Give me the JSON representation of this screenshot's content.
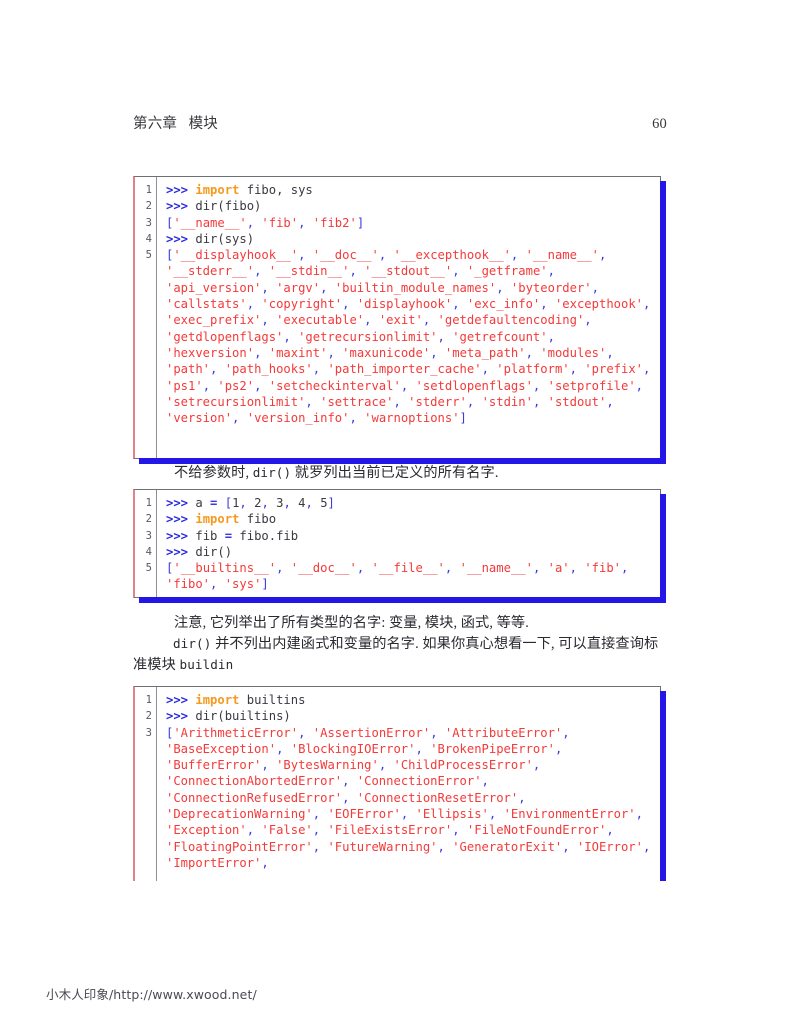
{
  "header": {
    "title": "第六章   模块",
    "page_number": "60"
  },
  "listings": [
    {
      "name": "dir-fibo-sys-listing",
      "line_numbers": [
        "1",
        "2",
        "3",
        "4",
        "5"
      ],
      "lines": [
        [
          {
            "t": ">>> ",
            "c": "prompt"
          },
          {
            "t": "import",
            "c": "kw"
          },
          {
            "t": " fibo, sys",
            "c": "plain"
          }
        ],
        [
          {
            "t": ">>> ",
            "c": "prompt"
          },
          {
            "t": "dir(fibo)",
            "c": "plain"
          }
        ],
        [
          {
            "t": "[",
            "c": "punct"
          },
          {
            "t": "'__name__'",
            "c": "str"
          },
          {
            "t": ", ",
            "c": "punct"
          },
          {
            "t": "'fib'",
            "c": "str"
          },
          {
            "t": ", ",
            "c": "punct"
          },
          {
            "t": "'fib2'",
            "c": "str"
          },
          {
            "t": "]",
            "c": "punct"
          }
        ],
        [
          {
            "t": ">>> ",
            "c": "prompt"
          },
          {
            "t": "dir(sys)",
            "c": "plain"
          }
        ],
        [
          {
            "t": "[",
            "c": "punct"
          },
          {
            "t": "'__displayhook__'",
            "c": "str"
          },
          {
            "t": ", ",
            "c": "punct"
          },
          {
            "t": "'__doc__'",
            "c": "str"
          },
          {
            "t": ", ",
            "c": "punct"
          },
          {
            "t": "'__excepthook__'",
            "c": "str"
          },
          {
            "t": ", ",
            "c": "punct"
          },
          {
            "t": "'__name__'",
            "c": "str"
          },
          {
            "t": ", ",
            "c": "punct"
          },
          {
            "t": "'__stderr__'",
            "c": "str"
          },
          {
            "t": ", ",
            "c": "punct"
          },
          {
            "t": "'__stdin__'",
            "c": "str"
          },
          {
            "t": ", ",
            "c": "punct"
          },
          {
            "t": "'__stdout__'",
            "c": "str"
          },
          {
            "t": ", ",
            "c": "punct"
          },
          {
            "t": "'_getframe'",
            "c": "str"
          },
          {
            "t": ", ",
            "c": "punct"
          },
          {
            "t": "'api_version'",
            "c": "str"
          },
          {
            "t": ", ",
            "c": "punct"
          },
          {
            "t": "'argv'",
            "c": "str"
          },
          {
            "t": ", ",
            "c": "punct"
          },
          {
            "t": "'builtin_module_names'",
            "c": "str"
          },
          {
            "t": ", ",
            "c": "punct"
          },
          {
            "t": "'byteorder'",
            "c": "str"
          },
          {
            "t": ", ",
            "c": "punct"
          },
          {
            "t": "'callstats'",
            "c": "str"
          },
          {
            "t": ", ",
            "c": "punct"
          },
          {
            "t": "'copyright'",
            "c": "str"
          },
          {
            "t": ", ",
            "c": "punct"
          },
          {
            "t": "'displayhook'",
            "c": "str"
          },
          {
            "t": ", ",
            "c": "punct"
          },
          {
            "t": "'exc_info'",
            "c": "str"
          },
          {
            "t": ", ",
            "c": "punct"
          },
          {
            "t": "'excepthook'",
            "c": "str"
          },
          {
            "t": ", ",
            "c": "punct"
          },
          {
            "t": "'exec_prefix'",
            "c": "str"
          },
          {
            "t": ", ",
            "c": "punct"
          },
          {
            "t": "'executable'",
            "c": "str"
          },
          {
            "t": ", ",
            "c": "punct"
          },
          {
            "t": "'exit'",
            "c": "str"
          },
          {
            "t": ", ",
            "c": "punct"
          },
          {
            "t": "'getdefaultencoding'",
            "c": "str"
          },
          {
            "t": ", ",
            "c": "punct"
          },
          {
            "t": "'getdlopenflags'",
            "c": "str"
          },
          {
            "t": ", ",
            "c": "punct"
          },
          {
            "t": "'getrecursionlimit'",
            "c": "str"
          },
          {
            "t": ", ",
            "c": "punct"
          },
          {
            "t": "'getrefcount'",
            "c": "str"
          },
          {
            "t": ", ",
            "c": "punct"
          },
          {
            "t": "'hexversion'",
            "c": "str"
          },
          {
            "t": ", ",
            "c": "punct"
          },
          {
            "t": "'maxint'",
            "c": "str"
          },
          {
            "t": ", ",
            "c": "punct"
          },
          {
            "t": "'maxunicode'",
            "c": "str"
          },
          {
            "t": ", ",
            "c": "punct"
          },
          {
            "t": "'meta_path'",
            "c": "str"
          },
          {
            "t": ", ",
            "c": "punct"
          },
          {
            "t": "'modules'",
            "c": "str"
          },
          {
            "t": ", ",
            "c": "punct"
          },
          {
            "t": "'path'",
            "c": "str"
          },
          {
            "t": ", ",
            "c": "punct"
          },
          {
            "t": "'path_hooks'",
            "c": "str"
          },
          {
            "t": ", ",
            "c": "punct"
          },
          {
            "t": "'path_importer_cache'",
            "c": "str"
          },
          {
            "t": ", ",
            "c": "punct"
          },
          {
            "t": "'platform'",
            "c": "str"
          },
          {
            "t": ", ",
            "c": "punct"
          },
          {
            "t": "'prefix'",
            "c": "str"
          },
          {
            "t": ", ",
            "c": "punct"
          },
          {
            "t": "'ps1'",
            "c": "str"
          },
          {
            "t": ", ",
            "c": "punct"
          },
          {
            "t": "'ps2'",
            "c": "str"
          },
          {
            "t": ", ",
            "c": "punct"
          },
          {
            "t": "'setcheckinterval'",
            "c": "str"
          },
          {
            "t": ", ",
            "c": "punct"
          },
          {
            "t": "'setdlopenflags'",
            "c": "str"
          },
          {
            "t": ", ",
            "c": "punct"
          },
          {
            "t": "'setprofile'",
            "c": "str"
          },
          {
            "t": ", ",
            "c": "punct"
          },
          {
            "t": "'setrecursionlimit'",
            "c": "str"
          },
          {
            "t": ", ",
            "c": "punct"
          },
          {
            "t": "'settrace'",
            "c": "str"
          },
          {
            "t": ", ",
            "c": "punct"
          },
          {
            "t": "'stderr'",
            "c": "str"
          },
          {
            "t": ", ",
            "c": "punct"
          },
          {
            "t": "'stdin'",
            "c": "str"
          },
          {
            "t": ", ",
            "c": "punct"
          },
          {
            "t": "'stdout'",
            "c": "str"
          },
          {
            "t": ", ",
            "c": "punct"
          },
          {
            "t": "'version'",
            "c": "str"
          },
          {
            "t": ", ",
            "c": "punct"
          },
          {
            "t": "'version_info'",
            "c": "str"
          },
          {
            "t": ", ",
            "c": "punct"
          },
          {
            "t": "'warnoptions'",
            "c": "str"
          },
          {
            "t": "]",
            "c": "punct"
          }
        ]
      ]
    },
    {
      "name": "dir-no-args-listing",
      "line_numbers": [
        "1",
        "2",
        "3",
        "4",
        "5"
      ],
      "lines": [
        [
          {
            "t": ">>> ",
            "c": "prompt"
          },
          {
            "t": "a ",
            "c": "plain"
          },
          {
            "t": "=",
            "c": "op"
          },
          {
            "t": " ",
            "c": "plain"
          },
          {
            "t": "[",
            "c": "punct"
          },
          {
            "t": "1",
            "c": "num"
          },
          {
            "t": ", ",
            "c": "punct"
          },
          {
            "t": "2",
            "c": "num"
          },
          {
            "t": ", ",
            "c": "punct"
          },
          {
            "t": "3",
            "c": "num"
          },
          {
            "t": ", ",
            "c": "punct"
          },
          {
            "t": "4",
            "c": "num"
          },
          {
            "t": ", ",
            "c": "punct"
          },
          {
            "t": "5",
            "c": "num"
          },
          {
            "t": "]",
            "c": "punct"
          }
        ],
        [
          {
            "t": ">>> ",
            "c": "prompt"
          },
          {
            "t": "import",
            "c": "kw"
          },
          {
            "t": " fibo",
            "c": "plain"
          }
        ],
        [
          {
            "t": ">>> ",
            "c": "prompt"
          },
          {
            "t": "fib ",
            "c": "plain"
          },
          {
            "t": "=",
            "c": "op"
          },
          {
            "t": " fibo.fib",
            "c": "plain"
          }
        ],
        [
          {
            "t": ">>> ",
            "c": "prompt"
          },
          {
            "t": "dir()",
            "c": "plain"
          }
        ],
        [
          {
            "t": "[",
            "c": "punct"
          },
          {
            "t": "'__builtins__'",
            "c": "str"
          },
          {
            "t": ", ",
            "c": "punct"
          },
          {
            "t": "'__doc__'",
            "c": "str"
          },
          {
            "t": ", ",
            "c": "punct"
          },
          {
            "t": "'__file__'",
            "c": "str"
          },
          {
            "t": ", ",
            "c": "punct"
          },
          {
            "t": "'__name__'",
            "c": "str"
          },
          {
            "t": ", ",
            "c": "punct"
          },
          {
            "t": "'a'",
            "c": "str"
          },
          {
            "t": ", ",
            "c": "punct"
          },
          {
            "t": "'fib'",
            "c": "str"
          },
          {
            "t": ", ",
            "c": "punct"
          },
          {
            "t": "'fibo'",
            "c": "str"
          },
          {
            "t": ", ",
            "c": "punct"
          },
          {
            "t": "'sys'",
            "c": "str"
          },
          {
            "t": "]",
            "c": "punct"
          }
        ]
      ]
    },
    {
      "name": "dir-builtins-listing",
      "line_numbers": [
        "1",
        "2",
        "3"
      ],
      "lines": [
        [
          {
            "t": ">>> ",
            "c": "prompt"
          },
          {
            "t": "import",
            "c": "kw"
          },
          {
            "t": " builtins",
            "c": "plain"
          }
        ],
        [
          {
            "t": ">>> ",
            "c": "prompt"
          },
          {
            "t": "dir(builtins)",
            "c": "plain"
          }
        ],
        [
          {
            "t": "[",
            "c": "punct"
          },
          {
            "t": "'ArithmeticError'",
            "c": "str"
          },
          {
            "t": ", ",
            "c": "punct"
          },
          {
            "t": "'AssertionError'",
            "c": "str"
          },
          {
            "t": ", ",
            "c": "punct"
          },
          {
            "t": "'AttributeError'",
            "c": "str"
          },
          {
            "t": ", ",
            "c": "punct"
          },
          {
            "t": "'BaseException'",
            "c": "str"
          },
          {
            "t": ", ",
            "c": "punct"
          },
          {
            "t": "'BlockingIOError'",
            "c": "str"
          },
          {
            "t": ", ",
            "c": "punct"
          },
          {
            "t": "'BrokenPipeError'",
            "c": "str"
          },
          {
            "t": ", ",
            "c": "punct"
          },
          {
            "t": "'BufferError'",
            "c": "str"
          },
          {
            "t": ", ",
            "c": "punct"
          },
          {
            "t": "'BytesWarning'",
            "c": "str"
          },
          {
            "t": ", ",
            "c": "punct"
          },
          {
            "t": "'ChildProcessError'",
            "c": "str"
          },
          {
            "t": ", ",
            "c": "punct"
          },
          {
            "t": "'ConnectionAbortedError'",
            "c": "str"
          },
          {
            "t": ", ",
            "c": "punct"
          },
          {
            "t": "'ConnectionError'",
            "c": "str"
          },
          {
            "t": ", ",
            "c": "punct"
          },
          {
            "t": "'ConnectionRefusedError'",
            "c": "str"
          },
          {
            "t": ", ",
            "c": "punct"
          },
          {
            "t": "'ConnectionResetError'",
            "c": "str"
          },
          {
            "t": ", ",
            "c": "punct"
          },
          {
            "t": "'DeprecationWarning'",
            "c": "str"
          },
          {
            "t": ", ",
            "c": "punct"
          },
          {
            "t": "'EOFError'",
            "c": "str"
          },
          {
            "t": ", ",
            "c": "punct"
          },
          {
            "t": "'Ellipsis'",
            "c": "str"
          },
          {
            "t": ", ",
            "c": "punct"
          },
          {
            "t": "'EnvironmentError'",
            "c": "str"
          },
          {
            "t": ", ",
            "c": "punct"
          },
          {
            "t": "'Exception'",
            "c": "str"
          },
          {
            "t": ", ",
            "c": "punct"
          },
          {
            "t": "'False'",
            "c": "str"
          },
          {
            "t": ", ",
            "c": "punct"
          },
          {
            "t": "'FileExistsError'",
            "c": "str"
          },
          {
            "t": ", ",
            "c": "punct"
          },
          {
            "t": "'FileNotFoundError'",
            "c": "str"
          },
          {
            "t": ", ",
            "c": "punct"
          },
          {
            "t": "'FloatingPointError'",
            "c": "str"
          },
          {
            "t": ", ",
            "c": "punct"
          },
          {
            "t": "'FutureWarning'",
            "c": "str"
          },
          {
            "t": ", ",
            "c": "punct"
          },
          {
            "t": "'GeneratorExit'",
            "c": "str"
          },
          {
            "t": ", ",
            "c": "punct"
          },
          {
            "t": "'IOError'",
            "c": "str"
          },
          {
            "t": ", ",
            "c": "punct"
          },
          {
            "t": "'ImportError'",
            "c": "str"
          },
          {
            "t": ", ",
            "c": "punct"
          }
        ]
      ]
    }
  ],
  "paragraphs": {
    "after_first": {
      "pre": "不给参数时, ",
      "code": "dir()",
      "post": " 就罗列出当前已定义的所有名字."
    },
    "after_second_a": "注意, 它列举出了所有类型的名字: 变量, 模块, 函式, 等等.",
    "after_second_b": {
      "code": "dir()",
      "text": " 并不列出内建函式和变量的名字. 如果你真心想看一下, 可以直接查询标准模块 ",
      "code2": "buildin"
    }
  },
  "watermark": "小木人印象/http://www.xwood.net/",
  "colors": {
    "prompt": "#2a2ae0",
    "keyword": "#f59a1e",
    "string": "#f43a3a",
    "punctuation": "#3a3ae0",
    "shadow": "#2516e8",
    "left_border": "#e4808c",
    "frame": "#6f6f78"
  }
}
